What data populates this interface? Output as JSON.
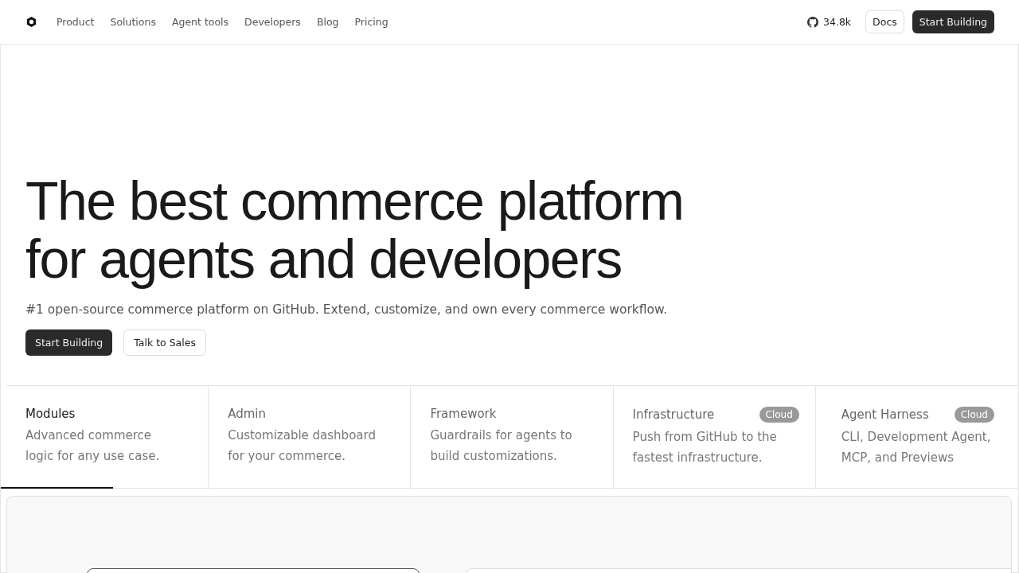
{
  "nav": {
    "links": [
      "Product",
      "Solutions",
      "Agent tools",
      "Developers",
      "Blog",
      "Pricing"
    ],
    "github_stars": "34.8k",
    "docs": "Docs",
    "cta": "Start Building"
  },
  "hero": {
    "title_lines": [
      "The best commerce platform",
      "for agents and developers"
    ],
    "subtitle": "#1 open-source commerce platform on GitHub. Extend, customize, and own every commerce workflow.",
    "primary": "Start Building",
    "secondary": "Talk to Sales"
  },
  "tabs": [
    {
      "title": "Modules",
      "description": "Advanced commerce logic for any use case.",
      "selected": true,
      "level": 0.54
    },
    {
      "title": "Admin",
      "description": "Customizable dashboard for your commerce.",
      "selected": false
    },
    {
      "title": "Framework",
      "description": "Guardrails for agents to build customizations.",
      "selected": false
    },
    {
      "title": "Infrastructure",
      "description": "Push from GitHub to the fastest infrastructure.",
      "selected": false,
      "badge": "Cloud"
    },
    {
      "title": "Agent Harness",
      "description": "CLI, Development Agent, MCP, and Previews",
      "selected": false,
      "badge": "Cloud"
    }
  ]
}
